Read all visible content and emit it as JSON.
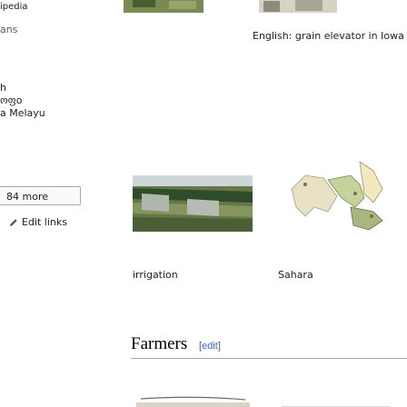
{
  "sidebar": {
    "clipped_label": "ipedia",
    "section_label": "ans",
    "items": [
      {
        "label": "h"
      },
      {
        "label": "ოფo"
      },
      {
        "label": "a Melayu"
      }
    ],
    "more_button": "84 more",
    "edit_links": "Edit links"
  },
  "gallery": [
    {
      "caption": "English: grain elevator in Iowa",
      "row": 1
    },
    {
      "caption": "irrigation",
      "row": 2
    },
    {
      "caption": "Sahara",
      "row": 2
    }
  ],
  "section": {
    "heading": "Farmers",
    "edit_bracket_open": "[",
    "edit_label": "edit",
    "edit_bracket_close": "]"
  },
  "colors": {
    "link": "#3366cc",
    "text": "#202122",
    "border": "#a2a9b1"
  }
}
